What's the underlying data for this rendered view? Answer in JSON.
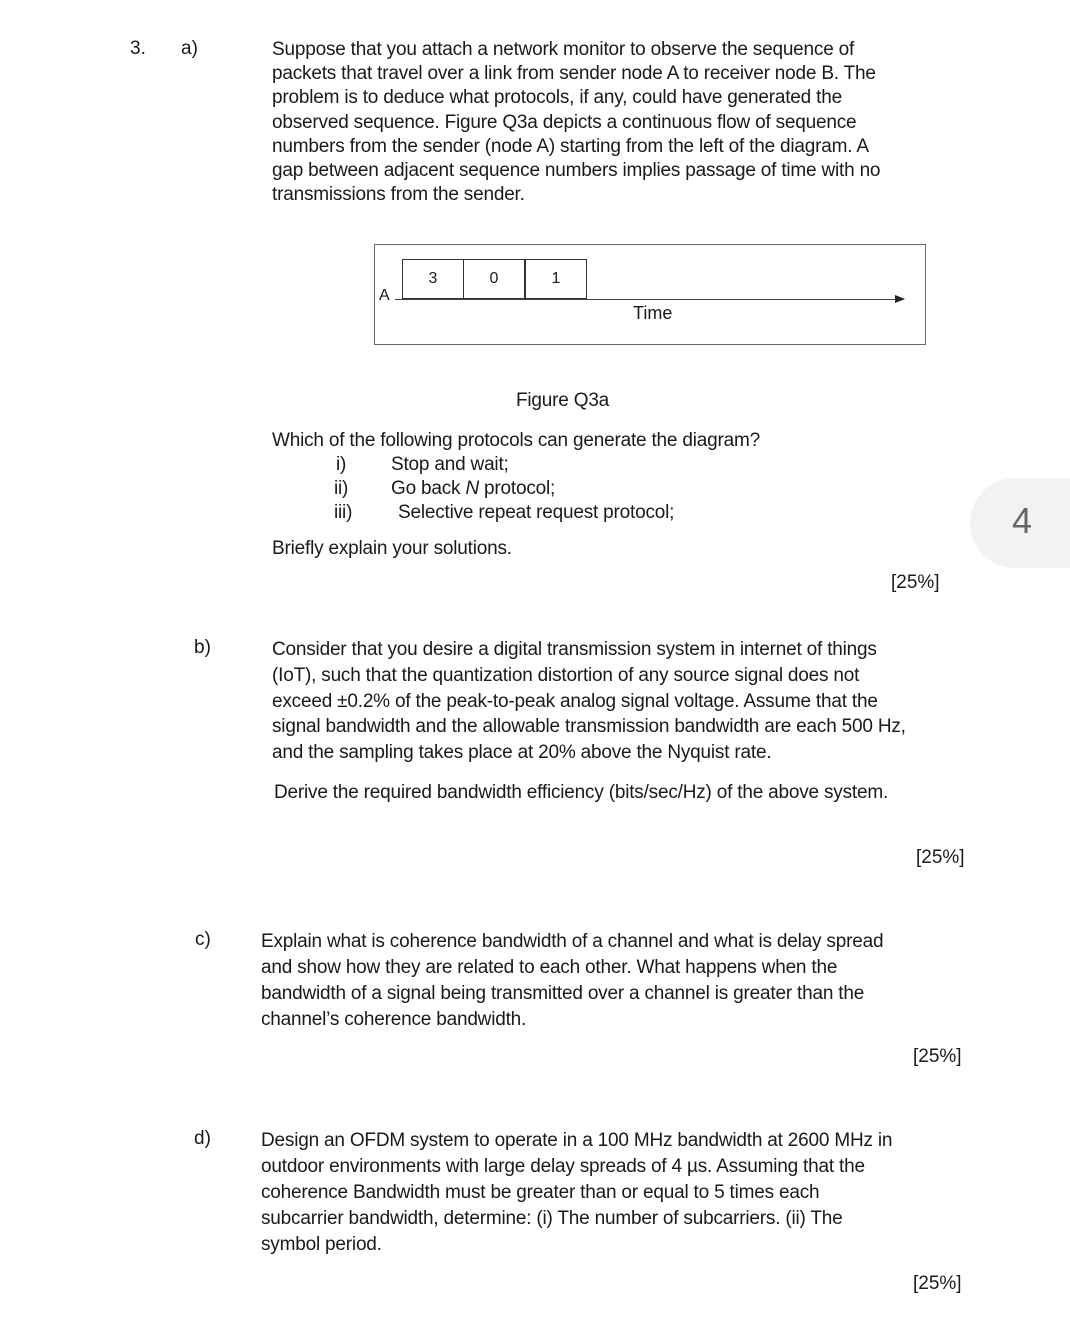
{
  "question": {
    "number": "3.",
    "parts": {
      "a": {
        "label": "a)",
        "lines": [
          "Suppose that you attach a network monitor to observe the sequence of",
          "packets that travel over a link from sender node A to receiver node B. The",
          "problem is to deduce what protocols, if any, could have generated the",
          "observed sequence. Figure Q3a depicts a continuous flow of sequence",
          "numbers from the sender (node A) starting from the left of the diagram. A",
          "gap between adjacent sequence numbers implies passage of time with no",
          "transmissions from the sender."
        ],
        "figure": {
          "node_label": "A",
          "frames": [
            "3",
            "0",
            "1"
          ],
          "axis_label": "Time",
          "caption": "Figure Q3a"
        },
        "prompt": "Which of the following protocols can generate the diagram?",
        "options": [
          {
            "num": "i)",
            "text": "Stop and wait;"
          },
          {
            "num": "ii)",
            "text_pre": "Go back ",
            "text_italic": "N",
            "text_post": " protocol;"
          },
          {
            "num": "iii)",
            "text": "Selective repeat request protocol;"
          }
        ],
        "instruction": "Briefly explain your solutions.",
        "weight": "[25%]"
      },
      "b": {
        "label": "b)",
        "lines": [
          "Consider that you desire a digital transmission system in internet of things",
          "(IoT), such that the quantization distortion of any source signal does not",
          "exceed ±0.2% of the peak-to-peak analog signal voltage. Assume that the",
          "signal bandwidth and the allowable transmission bandwidth are each 500 Hz,",
          "and the sampling takes place at 20% above the Nyquist rate."
        ],
        "task": "Derive the required bandwidth efficiency (bits/sec/Hz) of the above system.",
        "weight": "[25%]"
      },
      "c": {
        "label": "c)",
        "lines": [
          "Explain what is coherence bandwidth of a channel and what is delay spread",
          "and show how they are related to each other. What happens when the",
          "bandwidth of a signal being transmitted over a channel is greater than the",
          "channel’s coherence bandwidth."
        ],
        "weight": "[25%]"
      },
      "d": {
        "label": "d)",
        "lines": [
          "Design an OFDM system to operate in a 100 MHz bandwidth at 2600 MHz in",
          "outdoor environments with large delay spreads of 4 µs. Assuming that the",
          "coherence Bandwidth must be greater than or equal to 5 times each",
          "subcarrier bandwidth, determine: (i) The number of subcarriers. (ii) The",
          "symbol period."
        ],
        "weight": "[25%]"
      }
    }
  },
  "page_indicator": "4"
}
